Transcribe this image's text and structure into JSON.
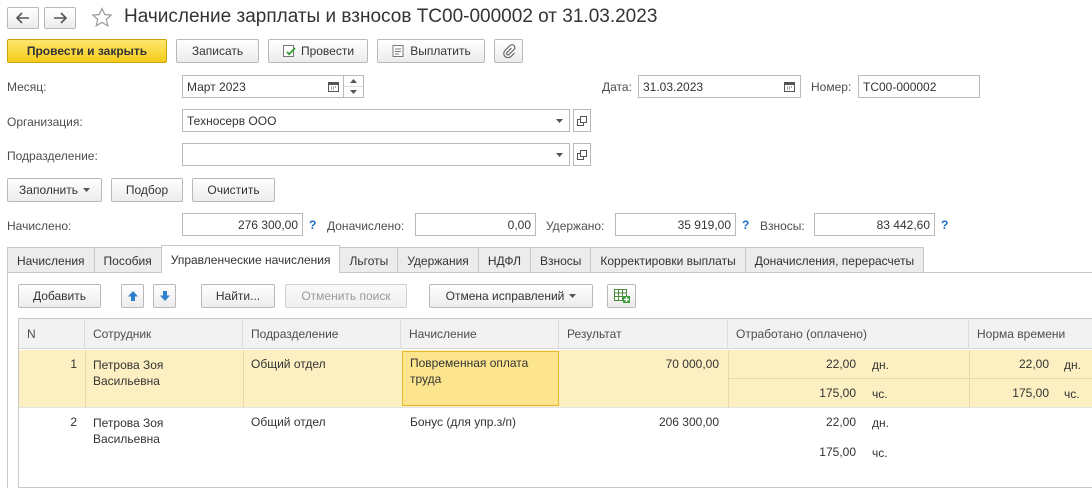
{
  "window": {
    "title": "Начисление зарплаты и взносов ТС00-000002 от 31.03.2023"
  },
  "toolbar": {
    "post_close": "Провести и закрыть",
    "save": "Записать",
    "post": "Провести",
    "pay": "Выплатить"
  },
  "form": {
    "month_label": "Месяц:",
    "month_value": "Март 2023",
    "date_label": "Дата:",
    "date_value": "31.03.2023",
    "number_label": "Номер:",
    "number_value": "ТС00-000002",
    "org_label": "Организация:",
    "org_value": "Техносерв ООО",
    "dept_label": "Подразделение:",
    "dept_value": ""
  },
  "actions": {
    "fill": "Заполнить",
    "select": "Подбор",
    "clear": "Очистить"
  },
  "totals": {
    "accrued_label": "Начислено:",
    "accrued_value": "276 300,00",
    "extra_label": "Доначислено:",
    "extra_value": "0,00",
    "withheld_label": "Удержано:",
    "withheld_value": "35 919,00",
    "contrib_label": "Взносы:",
    "contrib_value": "83 442,60",
    "help": "?"
  },
  "tabs": [
    "Начисления",
    "Пособия",
    "Управленческие начисления",
    "Льготы",
    "Удержания",
    "НДФЛ",
    "Взносы",
    "Корректировки выплаты",
    "Доначисления, перерасчеты"
  ],
  "active_tab": 2,
  "table_toolbar": {
    "add": "Добавить",
    "find": "Найти...",
    "cancel_search": "Отменить поиск",
    "cancel_fixes": "Отмена исправлений"
  },
  "columns": {
    "n": "N",
    "employee": "Сотрудник",
    "department": "Подразделение",
    "accrual": "Начисление",
    "result": "Результат",
    "worked": "Отработано (оплачено)",
    "norm": "Норма времени"
  },
  "rows": [
    {
      "n": "1",
      "employee_l1": "Петрова Зоя",
      "employee_l2": "Васильевна",
      "department": "Общий отдел",
      "accrual_l1": "Повременная оплата",
      "accrual_l2": "труда",
      "result": "70 000,00",
      "days": "22,00",
      "days_unit": "дн.",
      "hours": "175,00",
      "hours_unit": "чс.",
      "norm_days": "22,00",
      "norm_days_unit": "дн.",
      "norm_hours": "175,00",
      "norm_hours_unit": "чс."
    },
    {
      "n": "2",
      "employee_l1": "Петрова Зоя",
      "employee_l2": "Васильевна",
      "department": "Общий отдел",
      "accrual_l1": "Бонус (для упр.з/п)",
      "accrual_l2": "",
      "result": "206 300,00",
      "days": "22,00",
      "days_unit": "дн.",
      "hours": "175,00",
      "hours_unit": "чс."
    }
  ],
  "colors": {
    "primary": "#f5cc1a",
    "selection": "#fcefc1",
    "accent": "#1a6cc7"
  }
}
